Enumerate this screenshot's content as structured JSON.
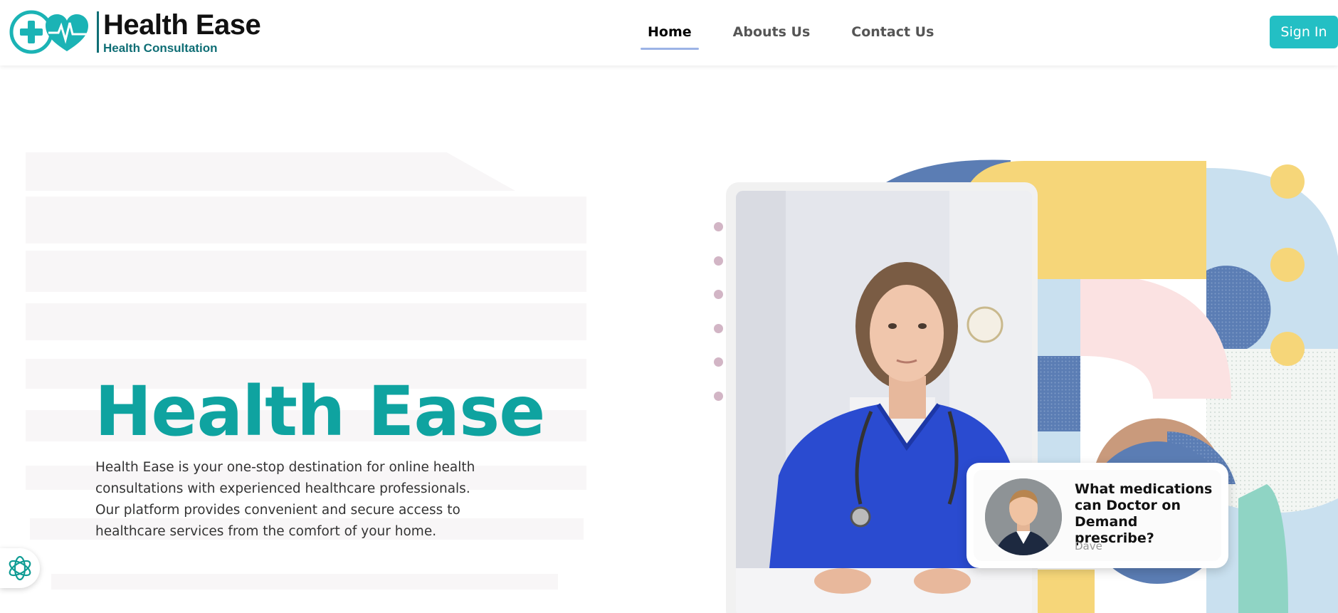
{
  "brand": {
    "title": "Health Ease",
    "subtitle": "Health Consultation",
    "logo_icon": "medical-cross-heart-icon",
    "color_primary": "#0fa3a0",
    "color_dark": "#0f6e75"
  },
  "nav": {
    "items": [
      {
        "label": "Home",
        "active": true
      },
      {
        "label": "Abouts Us",
        "active": false
      },
      {
        "label": "Contact Us",
        "active": false
      }
    ],
    "signin_label": "Sign In",
    "signin_color": "#23bfc4"
  },
  "hero": {
    "title": "Health Ease",
    "description": "Health Ease is your one-stop destination for online health consultations with experienced healthcare professionals. Our platform provides convenient and secure access to healthcare services from the comfort of your home."
  },
  "chat_card": {
    "question": "What medications can Doctor on Demand prescribe?",
    "name": "Dave"
  },
  "chat_widget": {
    "icon": "openai-flower-icon"
  },
  "palette": {
    "blue": "#5b7db4",
    "yellow": "#f6d679",
    "light_blue": "#c9e0ef",
    "pink": "#fbe2e2",
    "mint": "#8fd4c4",
    "tan": "#c99a7c"
  }
}
